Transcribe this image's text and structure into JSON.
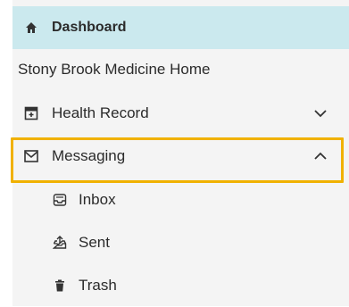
{
  "sidebar": {
    "items": [
      {
        "label": "Dashboard",
        "icon": "home-icon"
      },
      {
        "label": "Stony Brook Medicine Home"
      },
      {
        "label": "Health Record",
        "icon": "health-record-icon",
        "expanded": false
      },
      {
        "label": "Messaging",
        "icon": "envelope-icon",
        "expanded": true
      },
      {
        "label": "Inbox",
        "icon": "inbox-icon"
      },
      {
        "label": "Sent",
        "icon": "sent-icon"
      },
      {
        "label": "Trash",
        "icon": "trash-icon"
      }
    ]
  },
  "colors": {
    "active_bg": "#cbe9ee",
    "highlight_border": "#f0b100",
    "sidebar_bg": "#f4f4f4"
  }
}
